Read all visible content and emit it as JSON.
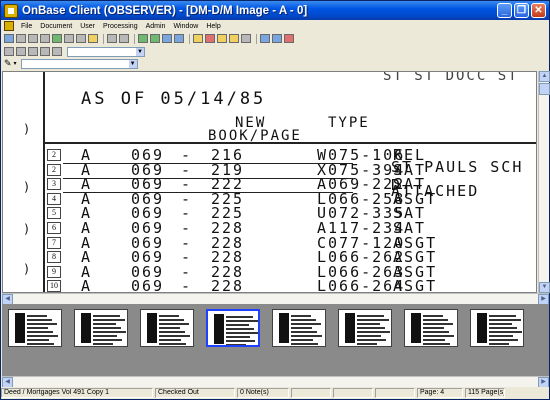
{
  "window": {
    "title": "OnBase Client (OBSERVER) - [DM-D/M Image - A - 0]"
  },
  "menu": [
    "File",
    "Document",
    "User",
    "Processing",
    "Admin",
    "Window",
    "Help"
  ],
  "document": {
    "top_fragment": "ST ST DOCC ST",
    "as_of": "AS OF 05/14/85",
    "header_new": "NEW",
    "header_book_page": "BOOK/PAGE",
    "header_type": "TYPE",
    "right_note_1": "ST PAULS SCH D",
    "right_note_2": "ATTACHED",
    "rows": [
      {
        "num": "2",
        "c1": "A",
        "c2": "069",
        "c3": "-",
        "c4": "216",
        "c5": "W075-106",
        "c6": "REL"
      },
      {
        "num": "2",
        "c1": "A",
        "c2": "069",
        "c3": "-",
        "c4": "219",
        "c5": "X075-394",
        "c6": "SAT"
      },
      {
        "num": "3",
        "c1": "A",
        "c2": "069",
        "c3": "-",
        "c4": "222",
        "c5": "A069-222",
        "c6": "SAT"
      },
      {
        "num": "4",
        "c1": "A",
        "c2": "069",
        "c3": "-",
        "c4": "225",
        "c5": "L066-258",
        "c6": "ASGT"
      },
      {
        "num": "5",
        "c1": "A",
        "c2": "069",
        "c3": "-",
        "c4": "225",
        "c5": "U072-335",
        "c6": "SAT"
      },
      {
        "num": "6",
        "c1": "A",
        "c2": "069",
        "c3": "-",
        "c4": "228",
        "c5": "A117-234",
        "c6": "SAT"
      },
      {
        "num": "7",
        "c1": "A",
        "c2": "069",
        "c3": "-",
        "c4": "228",
        "c5": "C077-120",
        "c6": "ASGT"
      },
      {
        "num": "8",
        "c1": "A",
        "c2": "069",
        "c3": "-",
        "c4": "228",
        "c5": "L066-262",
        "c6": "ASGT"
      },
      {
        "num": "9",
        "c1": "A",
        "c2": "069",
        "c3": "-",
        "c4": "228",
        "c5": "L066-263",
        "c6": "ASGT"
      },
      {
        "num": "10",
        "c1": "A",
        "c2": "069",
        "c3": "-",
        "c4": "228",
        "c5": "L066-264",
        "c6": "ASGT"
      }
    ]
  },
  "thumbnails": {
    "count": 8,
    "selected_index": 3
  },
  "status": {
    "doc": "Deed / Mortgages Vol 491 Copy 1",
    "checked": "Checked Out",
    "notes": "0  Note(s)",
    "page": "Page: 4",
    "pages": "115  Page(s)"
  }
}
